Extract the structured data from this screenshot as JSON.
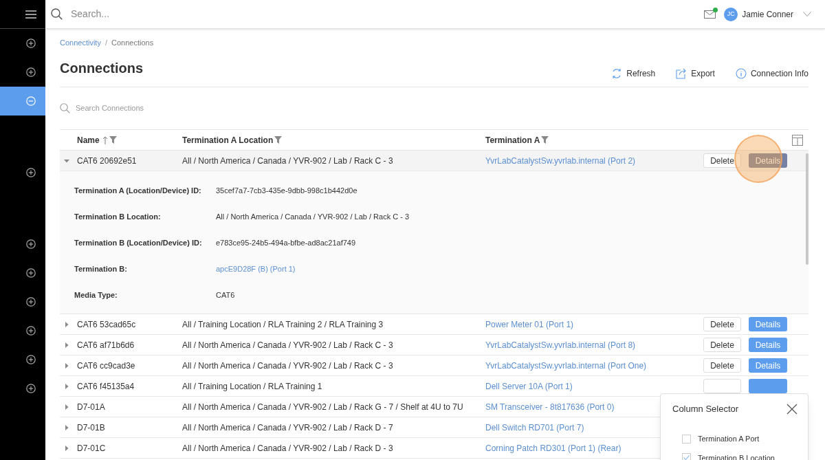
{
  "header": {
    "search_placeholder": "Search...",
    "has_unread_mail": true,
    "user": {
      "initials": "JC",
      "name": "Jamie Conner"
    }
  },
  "sidebar": {
    "items": [
      {
        "kind": "add",
        "selected": false
      },
      {
        "kind": "add",
        "selected": false
      },
      {
        "kind": "remove",
        "selected": true
      },
      {
        "kind": "gap"
      },
      {
        "kind": "add",
        "selected": false
      },
      {
        "kind": "gap"
      },
      {
        "kind": "add",
        "selected": false
      },
      {
        "kind": "add",
        "selected": false
      },
      {
        "kind": "add",
        "selected": false
      },
      {
        "kind": "add",
        "selected": false
      },
      {
        "kind": "add",
        "selected": false
      },
      {
        "kind": "add",
        "selected": false
      }
    ]
  },
  "breadcrumb": [
    {
      "label": "Connectivity",
      "link": true
    },
    {
      "separator": "/",
      "label": "Connections",
      "link": false
    }
  ],
  "title": "Connections",
  "toolbar": [
    {
      "kind": "refresh",
      "label": "Refresh"
    },
    {
      "kind": "export",
      "label": "Export"
    },
    {
      "kind": "info",
      "label": "Connection Info"
    }
  ],
  "table_search": {
    "placeholder": "Search Connections"
  },
  "table": {
    "columns": [
      {
        "label": "Name",
        "sorted": true,
        "filter": true
      },
      {
        "label": "Termination A Location",
        "sorted": false,
        "filter": true
      },
      {
        "label": "Termination A",
        "sorted": false,
        "filter": true
      }
    ],
    "rows": [
      {
        "name": "CAT6 20692e51",
        "location": "All / North America / Canada / YVR-902 / Lab / Rack C - 3",
        "termination_a": "YvrLabCatalystSw.yvrlab.internal (Port 2)",
        "expanded": true,
        "buttons": [
          {
            "kind": "delete",
            "label": "Delete"
          },
          {
            "kind": "details",
            "label": "Details",
            "pressed": true
          }
        ],
        "details": [
          {
            "label": "Termination A (Location/Device) ID:",
            "value": "35cef7a7-7cb3-435e-9dbb-998c1b442d0e",
            "link": false
          },
          {
            "label": "Termination B Location:",
            "value": "All / North America / Canada / YVR-902 / Lab / Rack C - 3",
            "link": false
          },
          {
            "label": "Termination B (Location/Device) ID:",
            "value": "e783ce95-24b5-494a-bfbe-ad8ac21af749",
            "link": false
          },
          {
            "label": "Termination B:",
            "value": "apcE9D28F (B) (Port 1)",
            "link": true
          },
          {
            "label": "Media Type:",
            "value": "CAT6",
            "link": false
          }
        ]
      },
      {
        "name": "CAT6 53cad65c",
        "location": "All / Training Location / RLA Training 2 / RLA Training 3",
        "termination_a": "Power Meter 01 (Port 1)",
        "expanded": false,
        "buttons": [
          {
            "kind": "delete",
            "label": "Delete"
          },
          {
            "kind": "details",
            "label": "Details",
            "pressed": false
          }
        ]
      },
      {
        "name": "CAT6 af71b6d6",
        "location": "All / North America / Canada / YVR-902 / Lab / Rack C - 3",
        "termination_a": "YvrLabCatalystSw.yvrlab.internal (Port 8)",
        "expanded": false,
        "buttons": [
          {
            "kind": "delete",
            "label": "Delete"
          },
          {
            "kind": "details",
            "label": "Details",
            "pressed": false
          }
        ]
      },
      {
        "name": "CAT6 cc9cad3e",
        "location": "All / North America / Canada / YVR-902 / Lab / Rack C - 3",
        "termination_a": "YvrLabCatalystSw.yvrlab.internal (Port One)",
        "expanded": false,
        "buttons": [
          {
            "kind": "delete",
            "label": "Delete"
          },
          {
            "kind": "details",
            "label": "Details",
            "pressed": false
          }
        ]
      },
      {
        "name": "CAT6 f45135a4",
        "location": "All / Training Location / RLA Training 1",
        "termination_a": "Dell Server 10A (Port 1)",
        "expanded": false,
        "buttons": [
          {
            "kind": "delete"
          },
          {
            "kind": "details"
          }
        ]
      },
      {
        "name": "D7-01A",
        "location": "All / North America / Canada / YVR-902 / Lab / Rack G - 7 / Shelf at 4U to 7U",
        "termination_a": "SM Transceiver - 8t817636 (Port 0)",
        "expanded": false
      },
      {
        "name": "D7-01B",
        "location": "All / North America / Canada / YVR-902 / Lab / Rack D - 7",
        "termination_a": "Dell Switch RD701 (Port 7)",
        "expanded": false
      },
      {
        "name": "D7-01C",
        "location": "All / North America / Canada / YVR-902 / Lab / Rack D - 3",
        "termination_a": "Corning Patch RD301 (Port 1) (Rear)",
        "expanded": false
      }
    ]
  },
  "column_selector": {
    "title": "Column Selector",
    "options": [
      {
        "label": "Termination A Port",
        "checked": false
      },
      {
        "label": "Termination B Location",
        "checked": true
      }
    ]
  }
}
